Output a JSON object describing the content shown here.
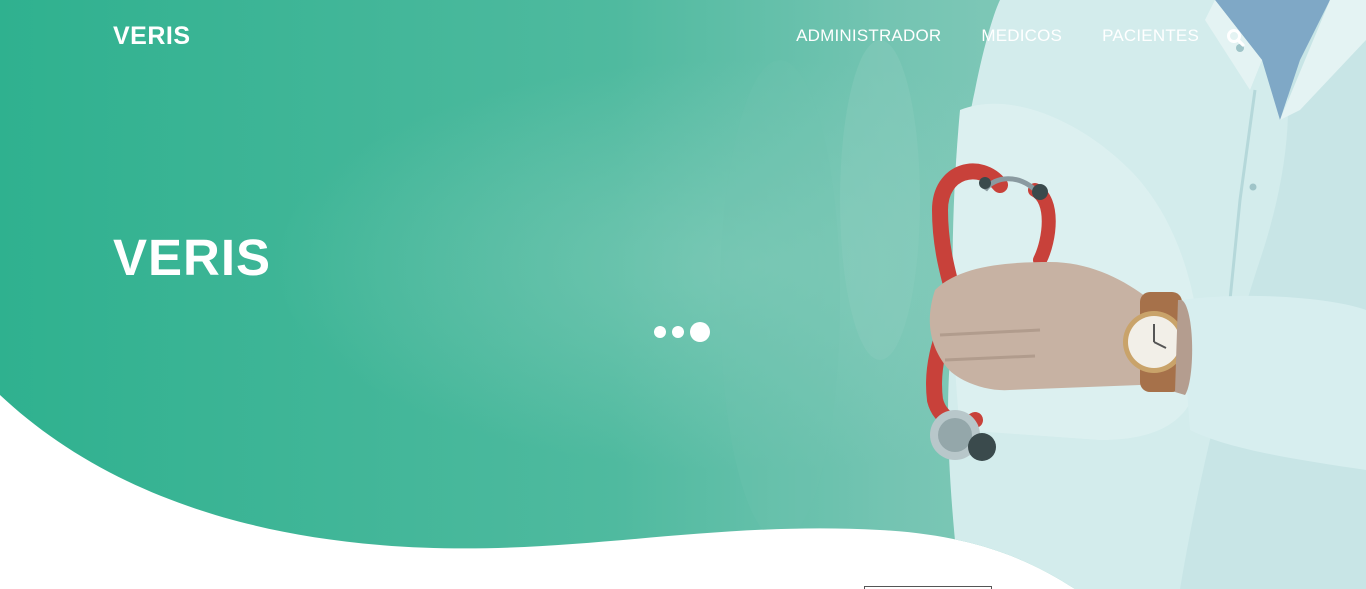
{
  "brand": {
    "name": "VERIS"
  },
  "nav": {
    "items": [
      {
        "label": "ADMINISTRADOR"
      },
      {
        "label": "MEDICOS"
      },
      {
        "label": "PACIENTES"
      }
    ],
    "search_icon": "search-icon"
  },
  "hero": {
    "title": "VERIS",
    "slides": {
      "count": 3,
      "active_index": 2
    }
  },
  "colors": {
    "primary_teal": "#2fb18f",
    "overlay_teal": "#5cc0a8",
    "coat": "#d9eef0",
    "stethoscope": "#c8413a",
    "white": "#ffffff"
  }
}
